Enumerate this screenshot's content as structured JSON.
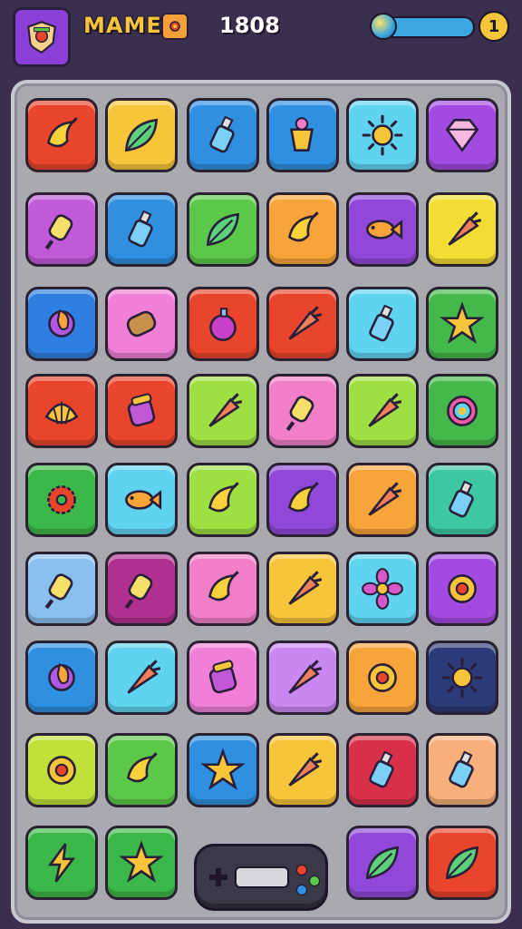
{
  "header": {
    "game_name": "MAME",
    "score": "1808",
    "coin_symbol": "1",
    "energy_fraction": 1.0,
    "avatar_icon": "shield-crest-icon",
    "badge_icon": "flower-badge-icon"
  },
  "colors": {
    "background": "#3b2f4f",
    "board": "#a9a9b0",
    "title": "#f7c53a",
    "energy": "#3ba7e0"
  },
  "board": {
    "columns": 6,
    "rows": 9,
    "tiles": [
      [
        {
          "color": "#e8452c",
          "icon": "banana"
        },
        {
          "color": "#f7c53a",
          "icon": "leaf"
        },
        {
          "color": "#2f8fe0",
          "icon": "bottle"
        },
        {
          "color": "#2f8fe0",
          "icon": "cup"
        },
        {
          "color": "#5fd3ef",
          "icon": "sun"
        },
        {
          "color": "#a24be0",
          "icon": "gem"
        }
      ],
      [
        {
          "color": "#c05ad8",
          "icon": "popsicle"
        },
        {
          "color": "#2f8fe0",
          "icon": "bottle"
        },
        {
          "color": "#5cc84a",
          "icon": "leaf"
        },
        {
          "color": "#f7a53a",
          "icon": "banana"
        },
        {
          "color": "#9048d8",
          "icon": "fish"
        },
        {
          "color": "#f2dd34",
          "icon": "carrot"
        }
      ],
      [
        {
          "color": "#2f7fe0",
          "icon": "planet"
        },
        {
          "color": "#f07fd8",
          "icon": "scroll"
        },
        {
          "color": "#e8452c",
          "icon": "apple"
        },
        {
          "color": "#e8452c",
          "icon": "carrot"
        },
        {
          "color": "#5fd3ef",
          "icon": "bottle"
        },
        {
          "color": "#44b84a",
          "icon": "star"
        }
      ],
      [
        {
          "color": "#e8452c",
          "icon": "shell"
        },
        {
          "color": "#e8452c",
          "icon": "jar"
        },
        {
          "color": "#9ee042",
          "icon": "carrot"
        },
        {
          "color": "#f07fc8",
          "icon": "popsicle"
        },
        {
          "color": "#9ee042",
          "icon": "carrot"
        },
        {
          "color": "#44b84a",
          "icon": "swirl"
        }
      ],
      [
        {
          "color": "#3cb84a",
          "icon": "gear"
        },
        {
          "color": "#5fd3ef",
          "icon": "fish"
        },
        {
          "color": "#9ee042",
          "icon": "banana"
        },
        {
          "color": "#9048d8",
          "icon": "banana"
        },
        {
          "color": "#f7a53a",
          "icon": "carrot"
        },
        {
          "color": "#3cc8a0",
          "icon": "bottle"
        }
      ],
      [
        {
          "color": "#8ac0f0",
          "icon": "popsicle"
        },
        {
          "color": "#b03090",
          "icon": "popsicle"
        },
        {
          "color": "#f07fc8",
          "icon": "banana"
        },
        {
          "color": "#f7c53a",
          "icon": "carrot"
        },
        {
          "color": "#5fd3ef",
          "icon": "flower"
        },
        {
          "color": "#a24be0",
          "icon": "donut"
        }
      ],
      [
        {
          "color": "#2f8fe0",
          "icon": "planet"
        },
        {
          "color": "#5fd3ef",
          "icon": "carrot"
        },
        {
          "color": "#f07fd8",
          "icon": "jar"
        },
        {
          "color": "#c888f0",
          "icon": "carrot"
        },
        {
          "color": "#f7a53a",
          "icon": "donut"
        },
        {
          "color": "#2b3a78",
          "icon": "sun"
        }
      ],
      [
        {
          "color": "#c0e03a",
          "icon": "donut"
        },
        {
          "color": "#5cc84a",
          "icon": "banana"
        },
        {
          "color": "#2f8fe0",
          "icon": "star"
        },
        {
          "color": "#f7c53a",
          "icon": "carrot"
        },
        {
          "color": "#d8304a",
          "icon": "bottle"
        },
        {
          "color": "#f7b07a",
          "icon": "bottle"
        }
      ],
      [
        {
          "color": "#3cb84a",
          "icon": "bolt"
        },
        {
          "color": "#3cb84a",
          "icon": "star"
        },
        null,
        null,
        {
          "color": "#9048d8",
          "icon": "leaf"
        },
        {
          "color": "#e8452c",
          "icon": "leaf"
        }
      ]
    ]
  },
  "console_icon": "game-controller-icon"
}
